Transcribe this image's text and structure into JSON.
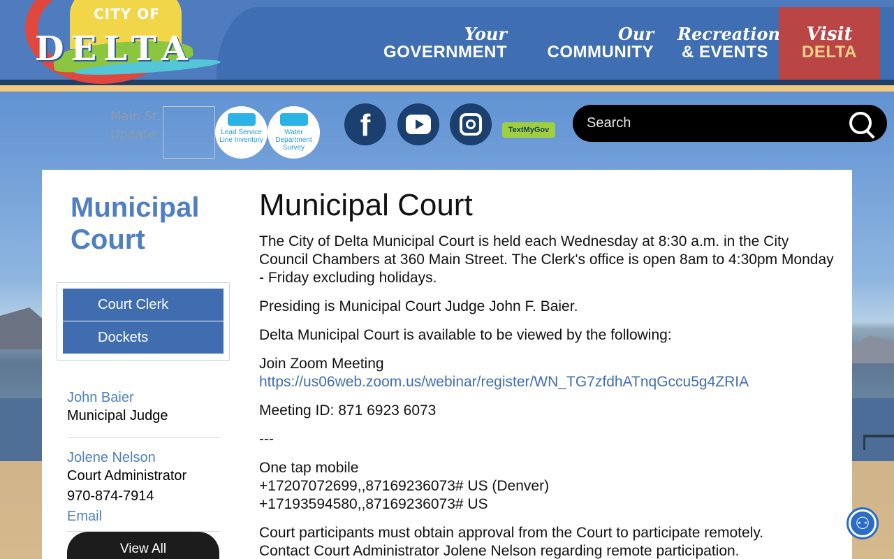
{
  "header": {
    "logo": {
      "city_of": "CITY OF",
      "name": "DELTA"
    },
    "nav": [
      {
        "script": "Your",
        "label": "GOVERNMENT"
      },
      {
        "script": "Our",
        "label": "COMMUNITY"
      },
      {
        "script": "Recreation",
        "label": "& EVENTS"
      },
      {
        "script": "Visit",
        "label": "DELTA"
      }
    ],
    "colors": {
      "header_blue": "#4f7cbf",
      "visit_red": "#b94545",
      "visit_gold": "#f5cf86"
    }
  },
  "utility": {
    "broken_image_alt": "Main St. Update",
    "lead_label": "Lead Service Line Inventory",
    "water_label": "Water Department Survey",
    "social": {
      "facebook": "facebook-icon",
      "youtube": "youtube-icon",
      "instagram": "instagram-icon"
    },
    "textmygov": "TextMyGov",
    "search_placeholder": "Search"
  },
  "sidebar": {
    "title": "Municipal Court",
    "menu": [
      {
        "label": "Court Clerk"
      },
      {
        "label": "Dockets"
      }
    ],
    "contacts": [
      {
        "name": "John Baier",
        "role": "Municipal Judge"
      },
      {
        "name": "Jolene Nelson",
        "role": "Court Administrator",
        "phone": "970-874-7914",
        "email_label": "Email"
      }
    ],
    "view_all": "View All"
  },
  "main": {
    "title": "Municipal Court",
    "p1": "The City of Delta Municipal Court is held each Wednesday at 8:30 a.m. in the City Council Chambers at 360 Main Street. The Clerk's office is open 8am to 4:30pm Monday - Friday excluding holidays.",
    "p2": "Presiding is Municipal Court Judge John F. Baier.",
    "p3": "Delta Municipal Court is available to be viewed by the following:",
    "zoom_label": "Join Zoom Meeting",
    "zoom_link": "https://us06web.zoom.us/webinar/register/WN_TG7zfdhATnqGccu5g4ZRIA",
    "meeting_id": "Meeting ID: 871 6923 6073",
    "separator": "---",
    "one_tap": "One tap mobile",
    "phone1": "+17207072699,,87169236073# US (Denver)",
    "phone2": "+17193594580,,87169236073# US",
    "p_last1": "Court participants must obtain approval from the Court to participate remotely.",
    "p_last2": "Contact Court Administrator Jolene Nelson regarding remote participation."
  },
  "accessibility_icon": "accessibility-icon"
}
